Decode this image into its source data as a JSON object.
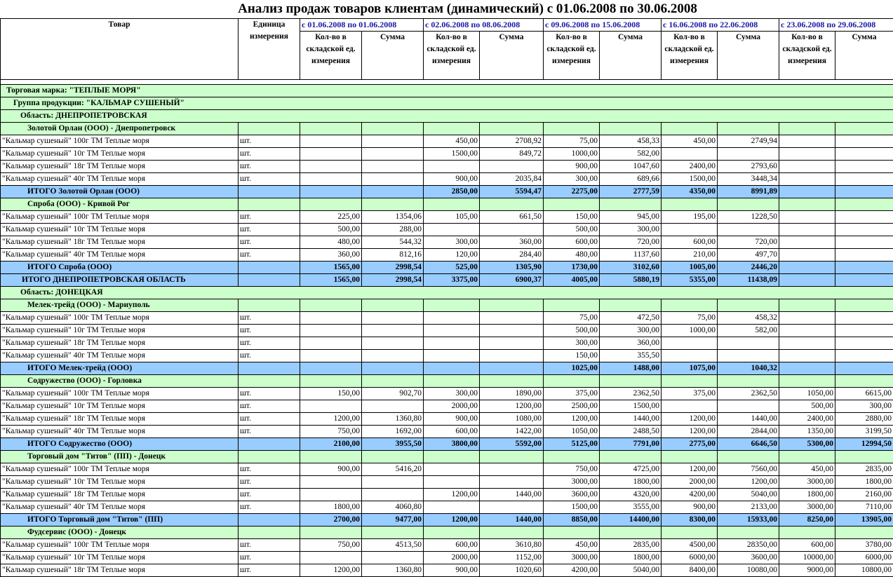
{
  "title": "Анализ продаж товаров клиентам (динамический) с 01.06.2008 по 30.06.2008",
  "headers": {
    "product": "Товар",
    "unit": "Единица измерения",
    "qty": "Кол-во в складской ед. измерения",
    "sum": "Сумма",
    "periods": [
      "с 01.06.2008 по 01.06.2008",
      "с 02.06.2008 по 08.06.2008",
      "с 09.06.2008 по 15.06.2008",
      "с 16.06.2008 по 22.06.2008",
      "с 23.06.2008 по 29.06.2008"
    ]
  },
  "rows": [
    {
      "type": "brand",
      "label": "Торговая марка: \"ТЕПЛЫЕ МОРЯ\""
    },
    {
      "type": "group",
      "label": "Группа продукции: \"КАЛЬМАР СУШЕНЫЙ\""
    },
    {
      "type": "region",
      "label": "Область: ДНЕПРОПЕТРОВСКАЯ"
    },
    {
      "type": "client",
      "label": "Золотой Орлан (ООО)  - Днепропетровск"
    },
    {
      "type": "item",
      "label": "\"Кальмар сушеный\" 100г ТМ Теплые моря",
      "unit": "шт.",
      "vals": [
        "",
        "",
        "450,00",
        "2708,92",
        "75,00",
        "458,33",
        "450,00",
        "2749,94",
        "",
        ""
      ]
    },
    {
      "type": "item",
      "label": "\"Кальмар сушеный\" 10г ТМ Теплые моря",
      "unit": "шт.",
      "vals": [
        "",
        "",
        "1500,00",
        "849,72",
        "1000,00",
        "582,00",
        "",
        "",
        "",
        ""
      ]
    },
    {
      "type": "item",
      "label": "\"Кальмар сушеный\" 18г ТМ Теплые моря",
      "unit": "шт.",
      "vals": [
        "",
        "",
        "",
        "",
        "900,00",
        "1047,60",
        "2400,00",
        "2793,60",
        "",
        ""
      ]
    },
    {
      "type": "item",
      "label": "\"Кальмар сушеный\" 40г ТМ Теплые моря",
      "unit": "шт.",
      "vals": [
        "",
        "",
        "900,00",
        "2035,84",
        "300,00",
        "689,66",
        "1500,00",
        "3448,34",
        "",
        ""
      ]
    },
    {
      "type": "total",
      "label": "ИТОГО Золотой Орлан (ООО)",
      "vals": [
        "",
        "",
        "2850,00",
        "5594,47",
        "2275,00",
        "2777,59",
        "4350,00",
        "8991,89",
        "",
        ""
      ]
    },
    {
      "type": "client",
      "label": "Спроба (ООО)  - Кривой Рог"
    },
    {
      "type": "item",
      "label": "\"Кальмар сушеный\" 100г ТМ Теплые моря",
      "unit": "шт.",
      "vals": [
        "225,00",
        "1354,06",
        "105,00",
        "661,50",
        "150,00",
        "945,00",
        "195,00",
        "1228,50",
        "",
        ""
      ]
    },
    {
      "type": "item",
      "label": "\"Кальмар сушеный\" 10г ТМ Теплые моря",
      "unit": "шт.",
      "vals": [
        "500,00",
        "288,00",
        "",
        "",
        "500,00",
        "300,00",
        "",
        "",
        "",
        ""
      ]
    },
    {
      "type": "item",
      "label": "\"Кальмар сушеный\" 18г ТМ Теплые моря",
      "unit": "шт.",
      "vals": [
        "480,00",
        "544,32",
        "300,00",
        "360,00",
        "600,00",
        "720,00",
        "600,00",
        "720,00",
        "",
        ""
      ]
    },
    {
      "type": "item",
      "label": "\"Кальмар сушеный\" 40г ТМ Теплые моря",
      "unit": "шт.",
      "vals": [
        "360,00",
        "812,16",
        "120,00",
        "284,40",
        "480,00",
        "1137,60",
        "210,00",
        "497,70",
        "",
        ""
      ]
    },
    {
      "type": "total",
      "label": "ИТОГО Спроба (ООО)",
      "vals": [
        "1565,00",
        "2998,54",
        "525,00",
        "1305,90",
        "1730,00",
        "3102,60",
        "1005,00",
        "2446,20",
        "",
        ""
      ]
    },
    {
      "type": "region-total",
      "label": "ИТОГО ДНЕПРОПЕТРОВСКАЯ ОБЛАСТЬ",
      "vals": [
        "1565,00",
        "2998,54",
        "3375,00",
        "6900,37",
        "4005,00",
        "5880,19",
        "5355,00",
        "11438,09",
        "",
        ""
      ]
    },
    {
      "type": "region",
      "label": "Область: ДОНЕЦКАЯ"
    },
    {
      "type": "client",
      "label": "Мелек-трейд (ООО)  - Мариуполь"
    },
    {
      "type": "item",
      "label": "\"Кальмар сушеный\" 100г ТМ Теплые моря",
      "unit": "шт.",
      "vals": [
        "",
        "",
        "",
        "",
        "75,00",
        "472,50",
        "75,00",
        "458,32",
        "",
        ""
      ]
    },
    {
      "type": "item",
      "label": "\"Кальмар сушеный\" 10г ТМ Теплые моря",
      "unit": "шт.",
      "vals": [
        "",
        "",
        "",
        "",
        "500,00",
        "300,00",
        "1000,00",
        "582,00",
        "",
        ""
      ]
    },
    {
      "type": "item",
      "label": "\"Кальмар сушеный\" 18г ТМ Теплые моря",
      "unit": "шт.",
      "vals": [
        "",
        "",
        "",
        "",
        "300,00",
        "360,00",
        "",
        "",
        "",
        ""
      ]
    },
    {
      "type": "item",
      "label": "\"Кальмар сушеный\" 40г ТМ Теплые моря",
      "unit": "шт.",
      "vals": [
        "",
        "",
        "",
        "",
        "150,00",
        "355,50",
        "",
        "",
        "",
        ""
      ]
    },
    {
      "type": "total",
      "label": "ИТОГО Мелек-трейд (ООО)",
      "vals": [
        "",
        "",
        "",
        "",
        "1025,00",
        "1488,00",
        "1075,00",
        "1040,32",
        "",
        ""
      ]
    },
    {
      "type": "client",
      "label": "Содружество (ООО)  - Горловка"
    },
    {
      "type": "item",
      "label": "\"Кальмар сушеный\" 100г ТМ Теплые моря",
      "unit": "шт.",
      "vals": [
        "150,00",
        "902,70",
        "300,00",
        "1890,00",
        "375,00",
        "2362,50",
        "375,00",
        "2362,50",
        "1050,00",
        "6615,00"
      ]
    },
    {
      "type": "item",
      "label": "\"Кальмар сушеный\" 10г ТМ Теплые моря",
      "unit": "шт.",
      "vals": [
        "",
        "",
        "2000,00",
        "1200,00",
        "2500,00",
        "1500,00",
        "",
        "",
        "500,00",
        "300,00"
      ]
    },
    {
      "type": "item",
      "label": "\"Кальмар сушеный\" 18г ТМ Теплые моря",
      "unit": "шт.",
      "vals": [
        "1200,00",
        "1360,80",
        "900,00",
        "1080,00",
        "1200,00",
        "1440,00",
        "1200,00",
        "1440,00",
        "2400,00",
        "2880,00"
      ]
    },
    {
      "type": "item",
      "label": "\"Кальмар сушеный\" 40г ТМ Теплые моря",
      "unit": "шт.",
      "vals": [
        "750,00",
        "1692,00",
        "600,00",
        "1422,00",
        "1050,00",
        "2488,50",
        "1200,00",
        "2844,00",
        "1350,00",
        "3199,50"
      ]
    },
    {
      "type": "total",
      "label": "ИТОГО Содружество (ООО)",
      "vals": [
        "2100,00",
        "3955,50",
        "3800,00",
        "5592,00",
        "5125,00",
        "7791,00",
        "2775,00",
        "6646,50",
        "5300,00",
        "12994,50"
      ]
    },
    {
      "type": "client",
      "label": "Торговый дом \"Титов\" (ПП)  - Донецк"
    },
    {
      "type": "item",
      "label": "\"Кальмар сушеный\" 100г ТМ Теплые моря",
      "unit": "шт.",
      "vals": [
        "900,00",
        "5416,20",
        "",
        "",
        "750,00",
        "4725,00",
        "1200,00",
        "7560,00",
        "450,00",
        "2835,00"
      ]
    },
    {
      "type": "item",
      "label": "\"Кальмар сушеный\" 10г ТМ Теплые моря",
      "unit": "шт.",
      "vals": [
        "",
        "",
        "",
        "",
        "3000,00",
        "1800,00",
        "2000,00",
        "1200,00",
        "3000,00",
        "1800,00"
      ]
    },
    {
      "type": "item",
      "label": "\"Кальмар сушеный\" 18г ТМ Теплые моря",
      "unit": "шт.",
      "vals": [
        "",
        "",
        "1200,00",
        "1440,00",
        "3600,00",
        "4320,00",
        "4200,00",
        "5040,00",
        "1800,00",
        "2160,00"
      ]
    },
    {
      "type": "item",
      "label": "\"Кальмар сушеный\" 40г ТМ Теплые моря",
      "unit": "шт.",
      "vals": [
        "1800,00",
        "4060,80",
        "",
        "",
        "1500,00",
        "3555,00",
        "900,00",
        "2133,00",
        "3000,00",
        "7110,00"
      ]
    },
    {
      "type": "total",
      "label": "ИТОГО Торговый дом \"Титов\" (ПП)",
      "vals": [
        "2700,00",
        "9477,00",
        "1200,00",
        "1440,00",
        "8850,00",
        "14400,00",
        "8300,00",
        "15933,00",
        "8250,00",
        "13905,00"
      ]
    },
    {
      "type": "client",
      "label": "Фудсервис (ООО)  - Донецк"
    },
    {
      "type": "item",
      "label": "\"Кальмар сушеный\" 100г ТМ Теплые моря",
      "unit": "шт.",
      "vals": [
        "750,00",
        "4513,50",
        "600,00",
        "3610,80",
        "450,00",
        "2835,00",
        "4500,00",
        "28350,00",
        "600,00",
        "3780,00"
      ]
    },
    {
      "type": "item",
      "label": "\"Кальмар сушеный\" 10г ТМ Теплые моря",
      "unit": "шт.",
      "vals": [
        "",
        "",
        "2000,00",
        "1152,00",
        "3000,00",
        "1800,00",
        "6000,00",
        "3600,00",
        "10000,00",
        "6000,00"
      ]
    },
    {
      "type": "item",
      "label": "\"Кальмар сушеный\" 18г ТМ Теплые моря",
      "unit": "шт.",
      "vals": [
        "1200,00",
        "1360,80",
        "900,00",
        "1020,60",
        "4200,00",
        "5040,00",
        "8400,00",
        "10080,00",
        "9000,00",
        "10800,00"
      ]
    }
  ]
}
